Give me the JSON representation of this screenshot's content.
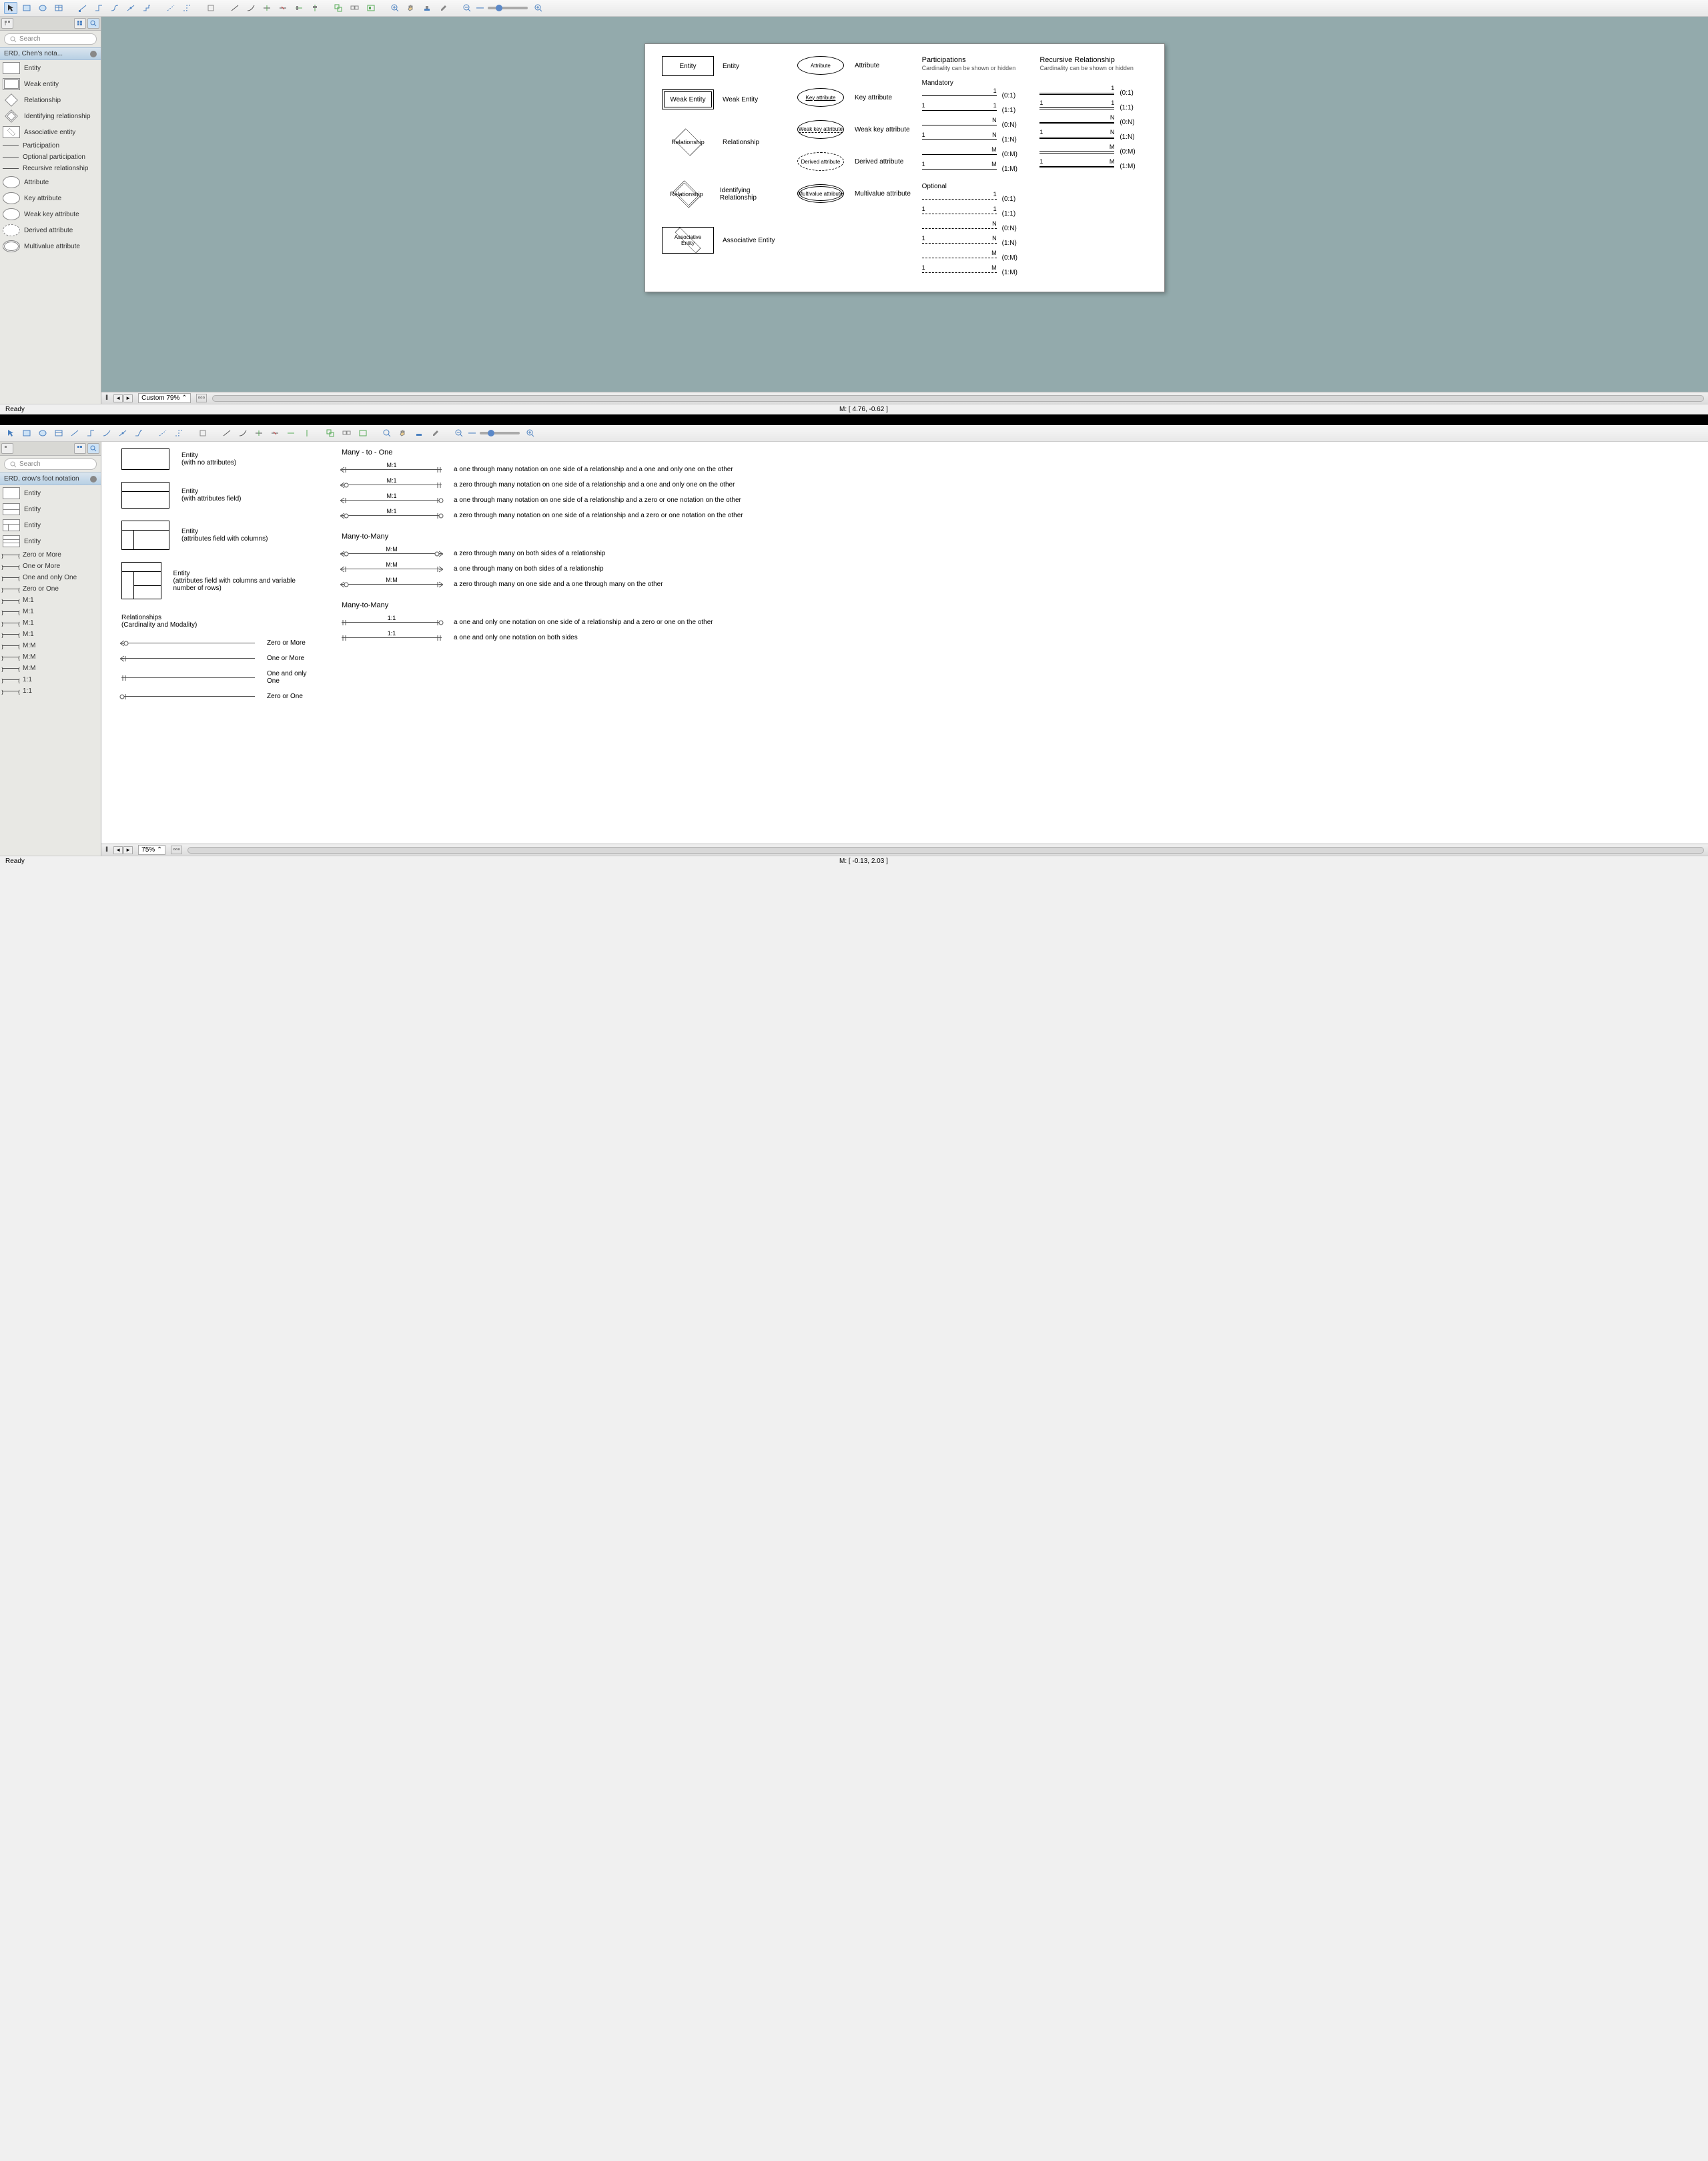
{
  "window1": {
    "toolbar": {
      "zoom_mode": "custom"
    },
    "sidebar": {
      "search_placeholder": "Search",
      "palette_title": "ERD, Chen's nota...",
      "items": [
        {
          "label": "Entity",
          "shape": "rect"
        },
        {
          "label": "Weak entity",
          "shape": "rect-double"
        },
        {
          "label": "Relationship",
          "shape": "diamond"
        },
        {
          "label": "Identifying relationship",
          "shape": "diamond-double"
        },
        {
          "label": "Associative entity",
          "shape": "assoc"
        },
        {
          "label": "Participation",
          "shape": "line"
        },
        {
          "label": "Optional participation",
          "shape": "line-dash"
        },
        {
          "label": "Recursive relationship",
          "shape": "line-double"
        },
        {
          "label": "Attribute",
          "shape": "ellipse"
        },
        {
          "label": "Key attribute",
          "shape": "ellipse"
        },
        {
          "label": "Weak key attribute",
          "shape": "ellipse"
        },
        {
          "label": "Derived attribute",
          "shape": "ellipse-dash"
        },
        {
          "label": "Multivalue attribute",
          "shape": "ellipse-double"
        }
      ]
    },
    "diagram": {
      "shapes_col": [
        {
          "shape": "rect",
          "text": "Entity",
          "label": "Entity"
        },
        {
          "shape": "rect-double",
          "text": "Weak Entity",
          "label": "Weak Entity"
        },
        {
          "shape": "diamond",
          "text": "Relationship",
          "label": "Relationship"
        },
        {
          "shape": "diamond-double",
          "text": "Relationship",
          "label": "Identifying Relationship"
        },
        {
          "shape": "assoc",
          "text": "Associative Entity",
          "label": "Associative Entity"
        }
      ],
      "attr_col": [
        {
          "shape": "ell",
          "text": "Attribute",
          "label": "Attribute"
        },
        {
          "shape": "ell",
          "text": "Key attribute",
          "label": "Key attribute",
          "underline": true
        },
        {
          "shape": "ell",
          "text": "Weak key attribute",
          "label": "Weak key attribute",
          "dash_under": true
        },
        {
          "shape": "ell-dash",
          "text": "Derived attribute",
          "label": "Derived attribute"
        },
        {
          "shape": "ell-double",
          "text": "Multivalue attribute",
          "label": "Multivalue attribute"
        }
      ],
      "participations": {
        "title": "Participations",
        "subtitle": "Cardinality can be shown or hidden",
        "mandatory_title": "Mandatory",
        "mandatory": [
          {
            "l": "",
            "r": "1",
            "label": "(0:1)"
          },
          {
            "l": "1",
            "r": "1",
            "label": "(1:1)"
          },
          {
            "l": "",
            "r": "N",
            "label": "(0:N)"
          },
          {
            "l": "1",
            "r": "N",
            "label": "(1:N)"
          },
          {
            "l": "",
            "r": "M",
            "label": "(0:M)"
          },
          {
            "l": "1",
            "r": "M",
            "label": "(1:M)"
          }
        ],
        "optional_title": "Optional",
        "optional": [
          {
            "l": "",
            "r": "1",
            "label": "(0:1)"
          },
          {
            "l": "1",
            "r": "1",
            "label": "(1:1)"
          },
          {
            "l": "",
            "r": "N",
            "label": "(0:N)"
          },
          {
            "l": "1",
            "r": "N",
            "label": "(1:N)"
          },
          {
            "l": "",
            "r": "M",
            "label": "(0:M)"
          },
          {
            "l": "1",
            "r": "M",
            "label": "(1:M)"
          }
        ]
      },
      "recursive": {
        "title": "Recursive Relationship",
        "subtitle": "Cardinality can be shown or hidden",
        "rows": [
          {
            "l": "",
            "r": "1",
            "label": "(0:1)"
          },
          {
            "l": "1",
            "r": "1",
            "label": "(1:1)"
          },
          {
            "l": "",
            "r": "N",
            "label": "(0:N)"
          },
          {
            "l": "1",
            "r": "N",
            "label": "(1:N)"
          },
          {
            "l": "",
            "r": "M",
            "label": "(0:M)"
          },
          {
            "l": "1",
            "r": "M",
            "label": "(1:M)"
          }
        ]
      }
    },
    "bottom": {
      "zoom": "Custom 79%",
      "cursor": "M: [ 4.76, -0.62 ]"
    },
    "status": "Ready"
  },
  "window2": {
    "sidebar": {
      "search_placeholder": "Search",
      "palette_title": "ERD, crow's foot notation",
      "items": [
        {
          "label": "Entity",
          "shape": "rect"
        },
        {
          "label": "Entity",
          "shape": "rect-split"
        },
        {
          "label": "Entity",
          "shape": "rect-cols"
        },
        {
          "label": "Entity",
          "shape": "rect-rows"
        },
        {
          "label": "Zero or More",
          "shape": "line"
        },
        {
          "label": "One or More",
          "shape": "line"
        },
        {
          "label": "One and only One",
          "shape": "line"
        },
        {
          "label": "Zero or One",
          "shape": "line"
        },
        {
          "label": "M:1",
          "shape": "line"
        },
        {
          "label": "M:1",
          "shape": "line"
        },
        {
          "label": "M:1",
          "shape": "line"
        },
        {
          "label": "M:1",
          "shape": "line"
        },
        {
          "label": "M:M",
          "shape": "line"
        },
        {
          "label": "M:M",
          "shape": "line"
        },
        {
          "label": "M:M",
          "shape": "line"
        },
        {
          "label": "1:1",
          "shape": "line"
        },
        {
          "label": "1:1",
          "shape": "line"
        }
      ]
    },
    "diagram": {
      "entities": [
        {
          "variant": "plain",
          "title": "Entity",
          "sub": "(with no attributes)"
        },
        {
          "variant": "split",
          "title": "Entity",
          "sub": "(with attributes field)"
        },
        {
          "variant": "cols",
          "title": "Entity",
          "sub": "(attributes field with columns)"
        },
        {
          "variant": "rows",
          "title": "Entity",
          "sub": "(attributes field with columns and variable number of rows)"
        }
      ],
      "rel_header": {
        "title": "Relationships",
        "sub": "(Cardinality and Modality)"
      },
      "basic_conns": [
        {
          "left": "zero-many",
          "label": "Zero or More"
        },
        {
          "left": "one-many",
          "label": "One or More"
        },
        {
          "left": "one-one",
          "label": "One and only One"
        },
        {
          "left": "zero-one",
          "label": "Zero or One"
        }
      ],
      "m1_title": "Many - to - One",
      "m1": [
        {
          "l": "one-many",
          "r": "one-one",
          "c": "M:1",
          "desc": "a one through many notation on one side of a relationship and a one and only one on the other"
        },
        {
          "l": "zero-many",
          "r": "one-one",
          "c": "M:1",
          "desc": "a zero through many notation on one side of a relationship and a one and only one on the other"
        },
        {
          "l": "one-many",
          "r": "zero-one",
          "c": "M:1",
          "desc": "a one through many notation on one side of a relationship and a zero or one notation on the other"
        },
        {
          "l": "zero-many",
          "r": "zero-one",
          "c": "M:1",
          "desc": "a zero through many notation on one side of a relationship and a zero or one notation on the other"
        }
      ],
      "mm_title": "Many-to-Many",
      "mm": [
        {
          "l": "zero-many",
          "r": "zero-many",
          "c": "M:M",
          "desc": "a zero through many on both sides of a relationship"
        },
        {
          "l": "one-many",
          "r": "one-many",
          "c": "M:M",
          "desc": "a one through many on both sides of a relationship"
        },
        {
          "l": "zero-many",
          "r": "one-many",
          "c": "M:M",
          "desc": "a zero through many on one side and a one through many on the other"
        }
      ],
      "oo_title": "Many-to-Many",
      "oo": [
        {
          "l": "one-one",
          "r": "zero-one",
          "c": "1:1",
          "desc": "a one and only one notation on one side of a relationship and a zero or one on the other"
        },
        {
          "l": "one-one",
          "r": "one-one",
          "c": "1:1",
          "desc": "a one and only one notation on both sides"
        }
      ]
    },
    "bottom": {
      "zoom": "75%",
      "cursor": "M: [ -0.13, 2.03 ]"
    },
    "status": "Ready"
  }
}
